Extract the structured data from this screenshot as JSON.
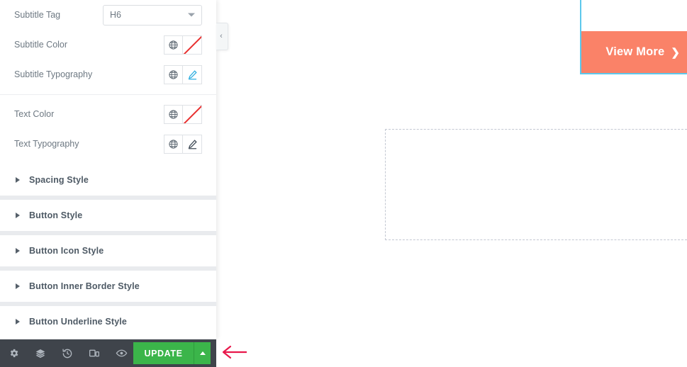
{
  "panel": {
    "controls": [
      {
        "label": "Subtitle Tag",
        "type": "select",
        "value": "H6",
        "icon": "chevron-down-icon"
      },
      {
        "label": "Subtitle Color",
        "type": "color",
        "value": "",
        "globe_icon": "globe-icon",
        "swatch_icon": "no-color-swatch-icon"
      },
      {
        "label": "Subtitle Typography",
        "type": "typography",
        "globe_icon": "globe-icon",
        "pencil_icon": "pencil-icon",
        "pencil_state": "active"
      }
    ],
    "controls_group_two": [
      {
        "label": "Text Color",
        "type": "color",
        "value": "",
        "globe_icon": "globe-icon",
        "swatch_icon": "no-color-swatch-icon"
      },
      {
        "label": "Text Typography",
        "type": "typography",
        "globe_icon": "globe-icon",
        "pencil_icon": "pencil-icon",
        "pencil_state": "inactive"
      }
    ],
    "accordion": [
      {
        "label": "Spacing Style",
        "icon": "triangle-right-icon"
      },
      {
        "label": "Button Style",
        "icon": "triangle-right-icon"
      },
      {
        "label": "Button Icon Style",
        "icon": "triangle-right-icon"
      },
      {
        "label": "Button Inner Border Style",
        "icon": "triangle-right-icon"
      },
      {
        "label": "Button Underline Style",
        "icon": "triangle-right-icon"
      }
    ],
    "collapse_handle": {
      "icon": "chevron-left-icon",
      "label": "‹"
    }
  },
  "bottom_bar": {
    "icons": [
      {
        "name": "settings-gear-icon",
        "title": "Settings"
      },
      {
        "name": "layers-navigator-icon",
        "title": "Navigator"
      },
      {
        "name": "history-clock-icon",
        "title": "History"
      },
      {
        "name": "responsive-device-icon",
        "title": "Responsive Mode"
      },
      {
        "name": "preview-eye-icon",
        "title": "Preview Changes"
      }
    ],
    "update_label": "UPDATE",
    "update_caret_icon": "caret-up-icon",
    "update_color": "#3bb54a",
    "bar_color": "#3f444b"
  },
  "canvas": {
    "view_more": {
      "label": "View More",
      "chevron": "❯",
      "chevron_icon": "chevron-right-icon",
      "background": "#fa8268",
      "text_color": "#ffffff"
    },
    "selection_color": "#5dc8ec",
    "placeholder_box": {
      "name": "empty-dashed-placeholder",
      "border_color": "#c3c8d2"
    }
  },
  "annotation": {
    "arrow_icon": "left-arrow-annotation",
    "color": "#e8174a"
  }
}
